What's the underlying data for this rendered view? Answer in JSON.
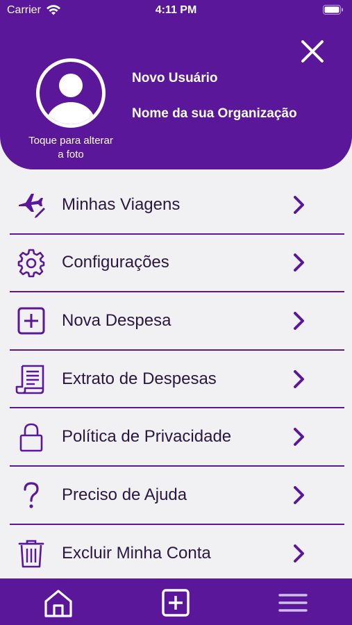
{
  "status_bar": {
    "carrier": "Carrier",
    "time": "4:11 PM"
  },
  "profile": {
    "name": "Novo Usuário",
    "organization": "Nome da sua Organização",
    "photo_hint": "Toque para alterar a foto"
  },
  "menu": {
    "items": [
      {
        "label": "Minhas Viagens",
        "icon": "airplane-edit-icon"
      },
      {
        "label": "Configurações",
        "icon": "gear-icon"
      },
      {
        "label": "Nova Despesa",
        "icon": "plus-square-icon"
      },
      {
        "label": "Extrato de Despesas",
        "icon": "receipt-icon"
      },
      {
        "label": "Política de Privacidade",
        "icon": "lock-icon"
      },
      {
        "label": "Preciso de Ajuda",
        "icon": "question-icon"
      },
      {
        "label": "Excluir Minha Conta",
        "icon": "trash-icon"
      }
    ]
  },
  "tabbar": {
    "icons": [
      "home-icon",
      "plus-square-icon",
      "menu-icon"
    ]
  },
  "colors": {
    "primary": "#5a179a",
    "background": "#f1f1f3",
    "text": "#2a1740"
  }
}
